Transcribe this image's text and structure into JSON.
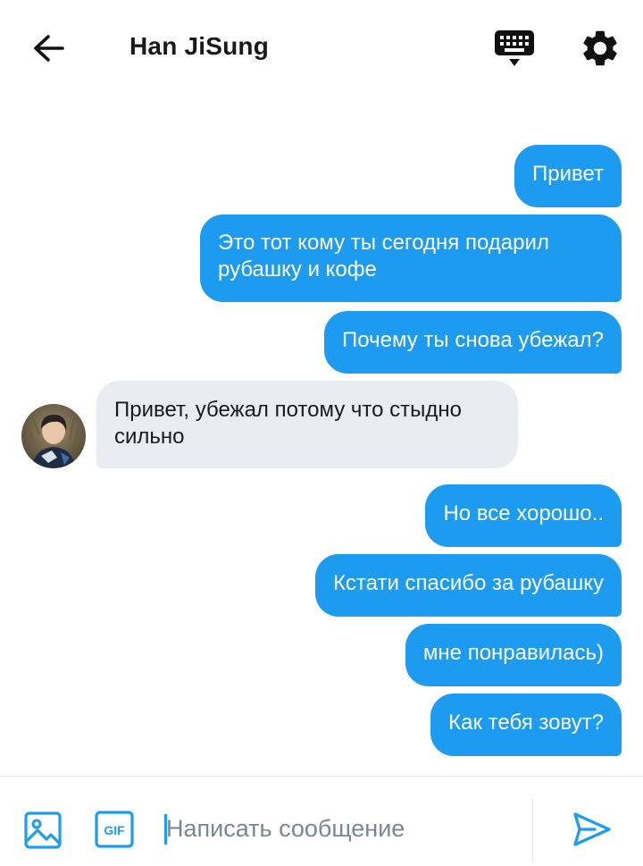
{
  "header": {
    "title": "Han JiSung"
  },
  "messages": [
    {
      "side": "out",
      "text": "Привет"
    },
    {
      "side": "out",
      "text": "Это тот кому ты сегодня подарил рубашку и кофе"
    },
    {
      "side": "out",
      "text": "Почему ты снова убежал?"
    },
    {
      "side": "in",
      "text": "Привет, убежал потому что стыдно сильно"
    },
    {
      "side": "out",
      "text": "Но все хорошо.."
    },
    {
      "side": "out",
      "text": "Кстати спасибо за рубашку"
    },
    {
      "side": "out",
      "text": "мне понравилась)"
    },
    {
      "side": "out",
      "text": "Как тебя зовут?"
    }
  ],
  "composer": {
    "placeholder": "Написать сообщение"
  },
  "icons": {
    "back": "arrow-left-icon",
    "keyboard": "keyboard-icon",
    "settings": "gear-icon",
    "image": "image-icon",
    "gif": "gif-icon",
    "send": "send-icon"
  },
  "colors": {
    "accent": "#1d9bf0",
    "incoming_bubble": "#e9edf2"
  }
}
